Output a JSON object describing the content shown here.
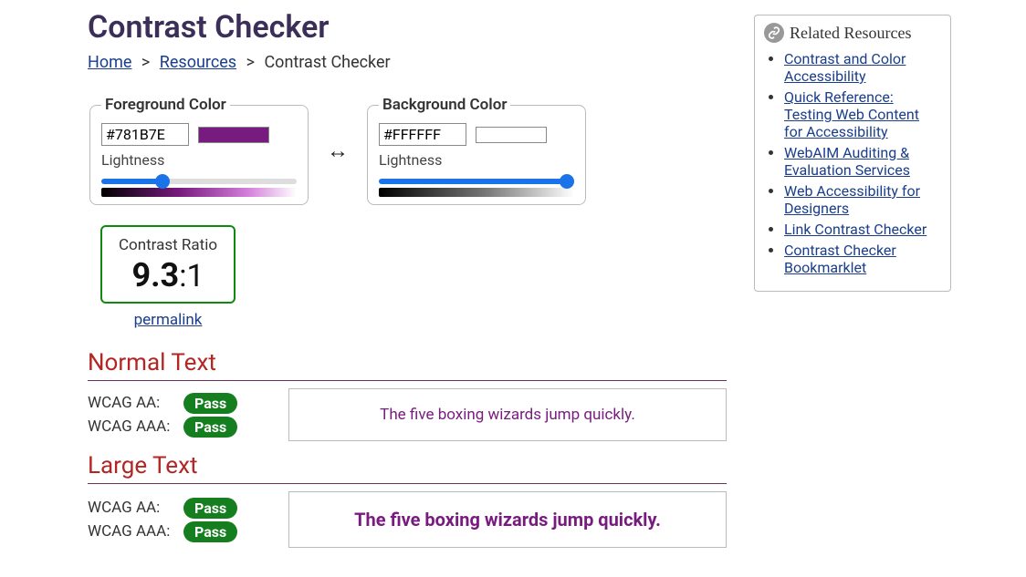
{
  "page": {
    "title": "Contrast Checker"
  },
  "breadcrumb": {
    "home": "Home",
    "resources": "Resources",
    "current": "Contrast Checker",
    "sep": ">"
  },
  "foreground": {
    "legend": "Foreground Color",
    "hex": "#781B7E",
    "swatch_color": "#781B7E",
    "lightness_label": "Lightness",
    "lightness_value": 30
  },
  "background": {
    "legend": "Background Color",
    "hex": "#FFFFFF",
    "swatch_color": "#FFFFFF",
    "lightness_label": "Lightness",
    "lightness_value": 100
  },
  "swap_label": "↔",
  "ratio": {
    "title": "Contrast Ratio",
    "value": "9.3",
    "suffix": ":1",
    "permalink": "permalink"
  },
  "normal": {
    "heading": "Normal Text",
    "aa_label": "WCAG AA:",
    "aa_result": "Pass",
    "aaa_label": "WCAG AAA:",
    "aaa_result": "Pass",
    "sample": "The five boxing wizards jump quickly."
  },
  "large": {
    "heading": "Large Text",
    "aa_label": "WCAG AA:",
    "aa_result": "Pass",
    "aaa_label": "WCAG AAA:",
    "aaa_result": "Pass",
    "sample": "The five boxing wizards jump quickly."
  },
  "sidebar": {
    "title": "Related Resources",
    "items": [
      "Contrast and Color Accessibility",
      "Quick Reference: Testing Web Content for Accessibility",
      "WebAIM Auditing & Evaluation Services",
      "Web Accessibility for Designers",
      "Link Contrast Checker",
      "Contrast Checker Bookmarklet"
    ]
  }
}
